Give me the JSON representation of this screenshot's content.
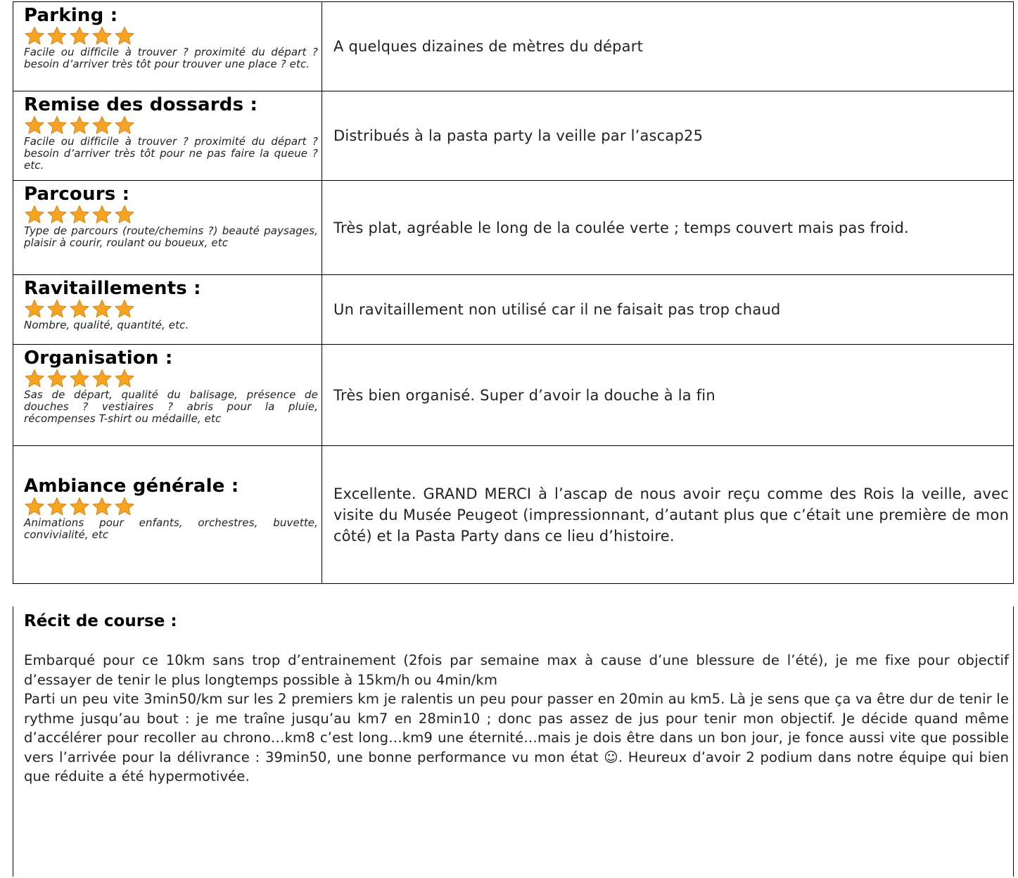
{
  "star_color": "#f7a520",
  "star_outline": "#d9831a",
  "rows": [
    {
      "title": "Parking :",
      "stars": 5,
      "hint": "Facile ou difficile à trouver ? proximité du départ ? besoin d’arriver très tôt pour trouver une place ? etc.",
      "value": "A quelques dizaines de mètres du départ"
    },
    {
      "title": "Remise des dossards :",
      "stars": 5,
      "hint": "Facile ou difficile à trouver ? proximité du départ ? besoin d’arriver très tôt pour ne pas faire la queue ? etc.",
      "value": "Distribués à la pasta party la veille par l’ascap25"
    },
    {
      "title": "Parcours :",
      "stars": 5,
      "hint": "Type de parcours (route/chemins ?) beauté paysages, plaisir à courir, roulant ou boueux, etc",
      "value": "Très plat, agréable le long de la coulée verte ; temps couvert mais pas froid."
    },
    {
      "title": "Ravitaillements :",
      "stars": 5,
      "hint": "Nombre, qualité, quantité, etc.",
      "value": "Un ravitaillement non utilisé car il ne faisait pas trop chaud"
    },
    {
      "title": "Organisation :",
      "stars": 5,
      "hint": "Sas de départ, qualité du balisage, présence de douches ? vestiaires ? abris pour la pluie, récompenses T-shirt ou médaille, etc",
      "value": "Très bien organisé. Super d’avoir la douche à la fin"
    },
    {
      "title": "Ambiance générale :",
      "stars": 5,
      "hint": "Animations pour enfants, orchestres, buvette, convivialité, etc",
      "value": "Excellente. GRAND MERCI à l’ascap de nous avoir reçu comme des Rois la veille, avec visite du Musée Peugeot (impressionnant, d’autant plus que c’était une première de mon côté) et la Pasta Party dans ce lieu d’histoire."
    }
  ],
  "recit": {
    "title": "Récit de course :",
    "paragraph1": "Embarqué pour ce 10km sans trop d’entrainement (2fois par semaine max à cause d’une blessure de l’été), je me fixe pour objectif d’essayer de tenir le plus longtemps possible à 15km/h ou 4min/km",
    "paragraph2": "Parti un peu vite 3min50/km sur les 2 premiers km je ralentis un peu pour passer en 20min au km5. Là je sens que ça va être dur de tenir le rythme jusqu’au bout : je me traîne jusqu’au km7 en 28min10 ; donc pas assez de jus pour tenir mon objectif. Je décide quand même d’accélérer pour recoller au chrono…km8 c’est long…km9 une éternité…mais je dois être dans un bon jour, je fonce aussi vite que possible vers l’arrivée pour la délivrance : 39min50, une bonne performance vu mon état ☺. Heureux d’avoir 2 podium dans notre équipe qui bien que réduite a été hypermotivée."
  }
}
